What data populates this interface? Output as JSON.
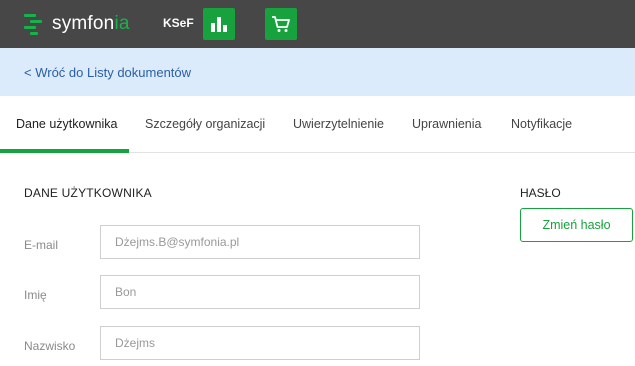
{
  "header": {
    "logo_text_main": "symfon",
    "logo_text_accent": "ia",
    "app_name": "KSeF",
    "apps": [
      {
        "icon": "bar-chart-icon"
      },
      {
        "icon": "cart-icon"
      }
    ],
    "colors": {
      "bar": "#474747",
      "brand": "#17a23d"
    }
  },
  "breadcrumb": {
    "back_label": "< Wróć do Listy dokumentów"
  },
  "tabs": [
    {
      "label": "Dane użytkownika",
      "active": true
    },
    {
      "label": "Szczegóły organizacji",
      "active": false
    },
    {
      "label": "Uwierzytelnienie",
      "active": false
    },
    {
      "label": "Uprawnienia",
      "active": false
    },
    {
      "label": "Notyfikacje",
      "active": false
    }
  ],
  "user_section": {
    "title": "DANE UŻYTKOWNIKA",
    "fields": [
      {
        "label": "E-mail",
        "value": "Dżejms.B@symfonia.pl"
      },
      {
        "label": "Imię",
        "value": "Bon"
      },
      {
        "label": "Nazwisko",
        "value": "Dżejms"
      }
    ]
  },
  "password_section": {
    "title": "HASŁO",
    "button_label": "Zmień hasło"
  }
}
